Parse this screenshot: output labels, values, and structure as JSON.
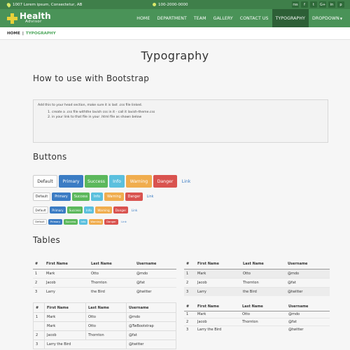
{
  "topbar": {
    "address": "1007 Lorem ipsum, Consectetur, AB",
    "phone": "100-2000-0000",
    "social": [
      "rss",
      "f",
      "t",
      "G+",
      "in",
      "p"
    ]
  },
  "logo": {
    "title": "Health",
    "subtitle": "Advisor"
  },
  "nav": {
    "items": [
      {
        "label": "HOME"
      },
      {
        "label": "DEPARTMENT"
      },
      {
        "label": "TEAM"
      },
      {
        "label": "GALLERY"
      },
      {
        "label": "CONTACT US"
      },
      {
        "label": "TYPOGRAPHY"
      },
      {
        "label": "DROPDOWN"
      }
    ]
  },
  "breadcrumb": {
    "home": "HOME",
    "sep": "|",
    "current": "TYPOGRAPHY"
  },
  "page_title": "Typography",
  "howto": {
    "heading": "How to use with Bootstrap",
    "intro": "Add this to your head section, make sure it is last .css file linked.",
    "steps": [
      "create a .css file withthe lavish css in it - call it lavish-theme.css",
      "in your link to that file in your .html file as shown below"
    ]
  },
  "buttons": {
    "heading": "Buttons",
    "labels": [
      "Default",
      "Primary",
      "Success",
      "Info",
      "Warning",
      "Danger",
      "Link"
    ]
  },
  "tables": {
    "heading": "Tables",
    "headers": [
      "#",
      "First Name",
      "Last Name",
      "Username"
    ],
    "t1": [
      [
        "1",
        "Mark",
        "Otto",
        "@mdo"
      ],
      [
        "2",
        "Jacob",
        "Thornton",
        "@fat"
      ],
      [
        "3",
        "Larry",
        "the Bird",
        "@twitter"
      ]
    ],
    "t2": [
      [
        "1",
        "Mark",
        "Otto",
        "@mdo"
      ],
      [
        "2",
        "Jacob",
        "Thornton",
        "@fat"
      ],
      [
        "3",
        "Larry",
        "the Bird",
        "@twitter"
      ]
    ],
    "t3": [
      [
        "1",
        "Mark",
        "Otto",
        "@mdo"
      ],
      [
        "",
        "Mark",
        "Otto",
        "@TwBootstrap"
      ],
      [
        "2",
        "Jacob",
        "Thornton",
        "@fat"
      ],
      [
        "3",
        "Larry the Bird",
        "",
        "@twitter"
      ]
    ],
    "t4": [
      [
        "1",
        "Mark",
        "Otto",
        "@mdo"
      ],
      [
        "2",
        "Jacob",
        "Thornton",
        "@fat"
      ],
      [
        "3",
        "Larry the Bird",
        "",
        "@twitter"
      ]
    ]
  },
  "colors": {
    "topbar": "#3f7f4a",
    "nav": "#4a9358",
    "nav_active": "#2d5f36",
    "logo_cross": "#e8d13a",
    "breadcrumb_current": "#4ca65a"
  }
}
